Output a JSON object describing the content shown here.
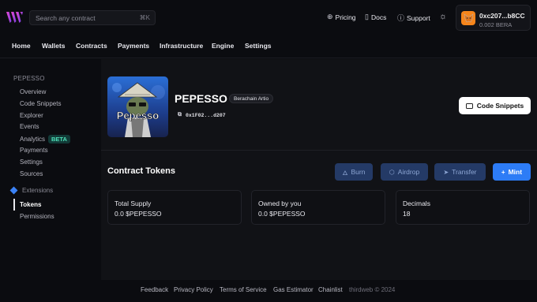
{
  "header": {
    "search_placeholder": "Search any contract",
    "search_shortcut": "⌘K",
    "nav": {
      "pricing": "Pricing",
      "docs": "Docs",
      "support": "Support"
    },
    "wallet": {
      "address": "0xc207...b8CC",
      "balance": "0.002 BERA"
    }
  },
  "main_nav": [
    "Home",
    "Wallets",
    "Contracts",
    "Payments",
    "Infrastructure",
    "Engine",
    "Settings"
  ],
  "sidebar": {
    "section": "PEPESSO",
    "items": [
      "Overview",
      "Code Snippets",
      "Explorer",
      "Events",
      "Analytics",
      "Payments",
      "Settings",
      "Sources"
    ],
    "analytics_badge": "BETA",
    "extensions_label": "Extensions",
    "extension_items": [
      "Tokens",
      "Permissions"
    ]
  },
  "contract": {
    "name": "PEPESSO",
    "chain": "Berachain Artio",
    "address": "0x1F02...d207",
    "thumbnail_text": "Pepesso",
    "code_snippets_label": "Code Snippets"
  },
  "tokens": {
    "title": "Contract Tokens",
    "actions": {
      "burn": "Burn",
      "airdrop": "Airdrop",
      "transfer": "Transfer",
      "mint": "Mint"
    },
    "stats": [
      {
        "label": "Total Supply",
        "value": "0.0 $PEPESSO"
      },
      {
        "label": "Owned by you",
        "value": "0.0 $PEPESSO"
      },
      {
        "label": "Decimals",
        "value": "18"
      }
    ]
  },
  "footer": {
    "links": [
      "Feedback",
      "Privacy Policy",
      "Terms of Service",
      "Gas Estimator",
      "Chainlist"
    ],
    "copyright": "thirdweb © 2024"
  },
  "colors": {
    "accent": "#2d7cf6",
    "logo_start": "#e14ad6",
    "logo_end": "#7b3fe4",
    "beta": "#4ee0b8"
  }
}
